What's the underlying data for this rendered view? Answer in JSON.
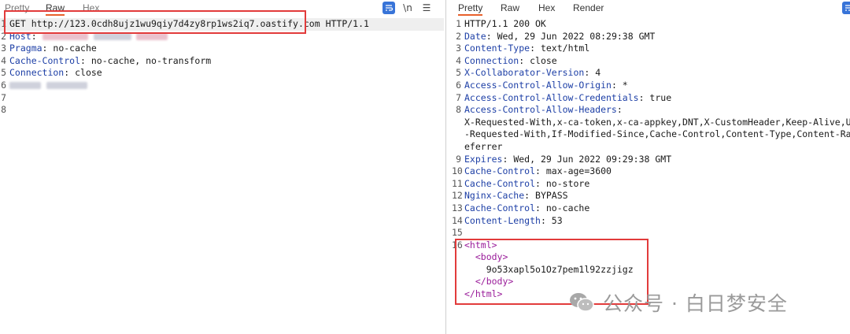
{
  "request": {
    "tabs": [
      "Pretty",
      "Raw",
      "Hex"
    ],
    "active_tab": "Raw",
    "newline_icon_label": "\\n",
    "lines": [
      {
        "n": "1",
        "text": "GET http://123.0cdh8ujz1wu9qiy7d4zy8rp1ws2iq7.oastify.com HTTP/1.1"
      },
      {
        "n": "2",
        "key": "Host",
        "sep": ":"
      },
      {
        "n": "3",
        "key": "Pragma",
        "sep": ":",
        "value": " no-cache"
      },
      {
        "n": "4",
        "key": "Cache-Control",
        "sep": ":",
        "value": " no-cache, no-transform"
      },
      {
        "n": "5",
        "key": "Connection",
        "sep": ":",
        "value": " close"
      },
      {
        "n": "6"
      },
      {
        "n": "7"
      },
      {
        "n": "8"
      }
    ]
  },
  "response": {
    "tabs": [
      "Pretty",
      "Raw",
      "Hex",
      "Render"
    ],
    "active_tab": "Pretty",
    "lines": [
      {
        "n": "1",
        "text": "HTTP/1.1 200 OK"
      },
      {
        "n": "2",
        "key": "Date",
        "sep": ":",
        "value": " Wed, 29 Jun 2022 08:29:38 GMT"
      },
      {
        "n": "3",
        "key": "Content-Type",
        "sep": ":",
        "value": " text/html"
      },
      {
        "n": "4",
        "key": "Connection",
        "sep": ":",
        "value": " close"
      },
      {
        "n": "5",
        "key": "X-Collaborator-Version",
        "sep": ":",
        "value": " 4"
      },
      {
        "n": "6",
        "key": "Access-Control-Allow-Origin",
        "sep": ":",
        "value": " *"
      },
      {
        "n": "7",
        "key": "Access-Control-Allow-Credentials",
        "sep": ":",
        "value": " true"
      },
      {
        "n": "8",
        "key": "Access-Control-Allow-Headers",
        "sep": ":"
      },
      {
        "n": "",
        "text": "X-Requested-With,x-ca-token,x-ca-appkey,DNT,X-CustomHeader,Keep-Alive,User"
      },
      {
        "n": "",
        "text": "-Requested-With,If-Modified-Since,Cache-Control,Content-Type,Content-Range,R"
      },
      {
        "n": "",
        "text": "eferrer"
      },
      {
        "n": "9",
        "key": "Expires",
        "sep": ":",
        "value": " Wed, 29 Jun 2022 09:29:38 GMT"
      },
      {
        "n": "10",
        "key": "Cache-Control",
        "sep": ":",
        "value": " max-age=3600"
      },
      {
        "n": "11",
        "key": "Cache-Control",
        "sep": ":",
        "value": " no-store"
      },
      {
        "n": "12",
        "key": "Nginx-Cache",
        "sep": ":",
        "value": " BYPASS"
      },
      {
        "n": "13",
        "key": "Cache-Control",
        "sep": ":",
        "value": " no-cache"
      },
      {
        "n": "14",
        "key": "Content-Length",
        "sep": ":",
        "value": " 53"
      },
      {
        "n": "15"
      },
      {
        "n": "16",
        "tag": "<html>"
      },
      {
        "n": "",
        "indent": "  ",
        "tag": "<body>"
      },
      {
        "n": "",
        "indent": "    ",
        "text": "9o53xapl5o1Oz7pem1l92zzjigz"
      },
      {
        "n": "",
        "indent": "  ",
        "tag": "</body>"
      },
      {
        "n": "",
        "tag": "</html>"
      }
    ]
  },
  "watermark": {
    "text": "公众号 · 白日梦安全",
    "logo": "wechat-logo-icon"
  },
  "colors": {
    "key": "#1d3fa6",
    "tag": "#9a1c9a",
    "highlight_box": "#e23b3b",
    "active_tab_underline": "#e8612c",
    "wrap_icon": "#3874d8"
  }
}
